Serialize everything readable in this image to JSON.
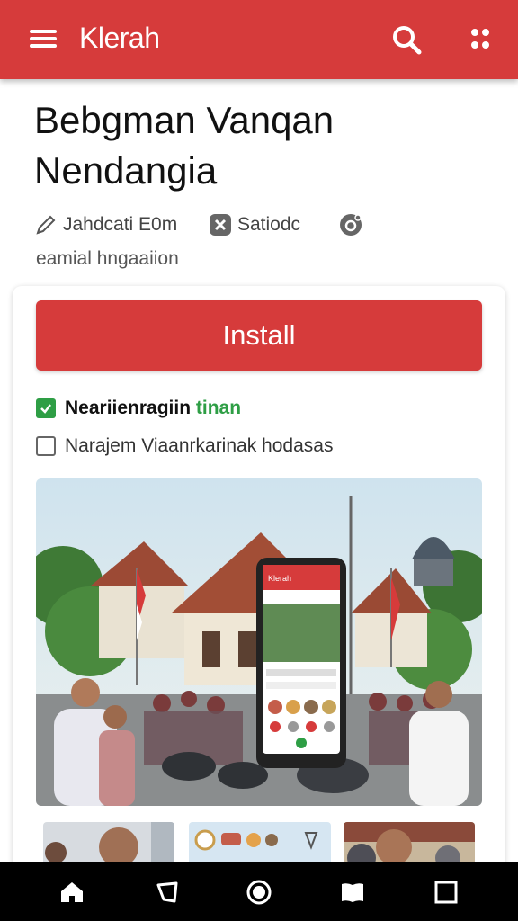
{
  "app_bar": {
    "title": "Klerah",
    "icons": [
      "menu-icon",
      "search-icon",
      "more-icon"
    ],
    "color": "#d63b3b"
  },
  "article": {
    "title": "Bebgman Vanqan Nendangia",
    "author": "Jahdcati E0m",
    "source": "Satiodc",
    "subtitle": "eamial hngaaiion"
  },
  "card": {
    "install_label": "Install",
    "option_1": {
      "text_strong": "Neariienragiin",
      "text_accent": "tinan",
      "checked": true
    },
    "option_2": {
      "text": "Narajem Viaanrkarinak hodasas",
      "checked": false
    }
  },
  "hero": {
    "phone_screen_header": "Klerah"
  },
  "bottom_nav": {
    "icons": [
      "home-icon",
      "shape-icon",
      "circle-icon",
      "book-icon",
      "square-icon"
    ]
  }
}
